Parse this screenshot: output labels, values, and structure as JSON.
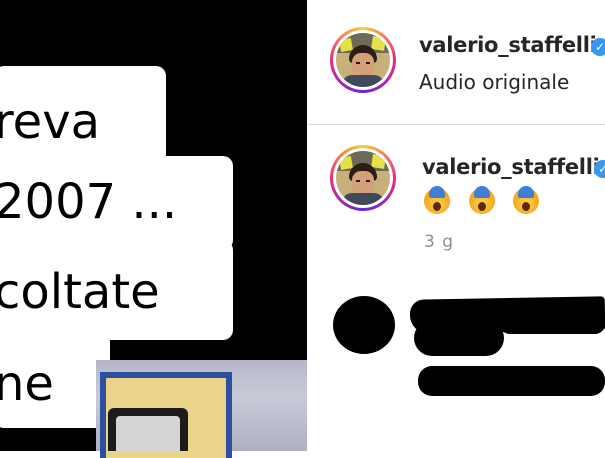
{
  "video": {
    "caption_lines": [
      "reva",
      "2007 ...",
      "coltate",
      "ne"
    ]
  },
  "header": {
    "username": "valerio_staffelli",
    "verified_icon": "verified-badge-icon",
    "audio_label": "Audio originale"
  },
  "comment": {
    "username": "valerio_staffelli",
    "verified_icon": "verified-badge-icon",
    "emoji_icon": "face-screaming-in-fear-icon",
    "emoji_count": 3,
    "timestamp": "3 g"
  },
  "colors": {
    "verified": "#3897f0",
    "text": "#262626",
    "muted": "#8e8e8e",
    "divider": "#dbdbdb"
  }
}
